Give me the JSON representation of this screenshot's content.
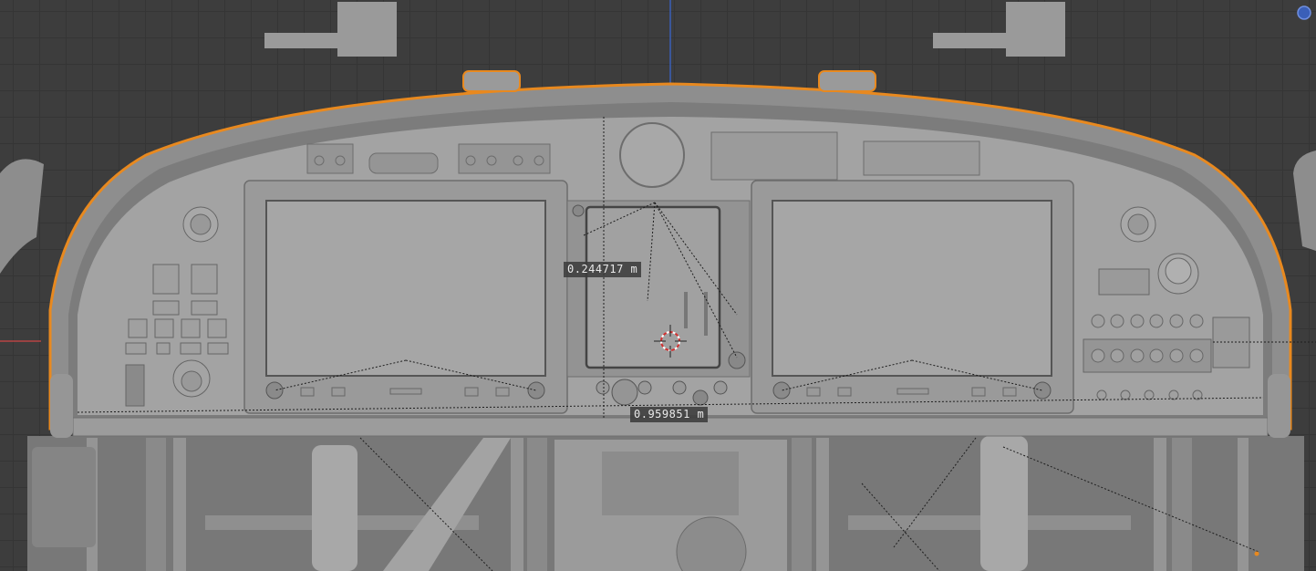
{
  "viewport": {
    "mode": "3D viewport",
    "selected_object": "instrument panel",
    "selection_outline_color": "#e8891f",
    "background_color": "#3d3d3d",
    "grid_color": "#353535"
  },
  "measurements": [
    {
      "label": "0.244717 m"
    },
    {
      "label": "0.959851 m"
    }
  ],
  "icons": {
    "cursor": "3d-cursor-icon",
    "gizmo": "navigation-gizmo-icon"
  }
}
